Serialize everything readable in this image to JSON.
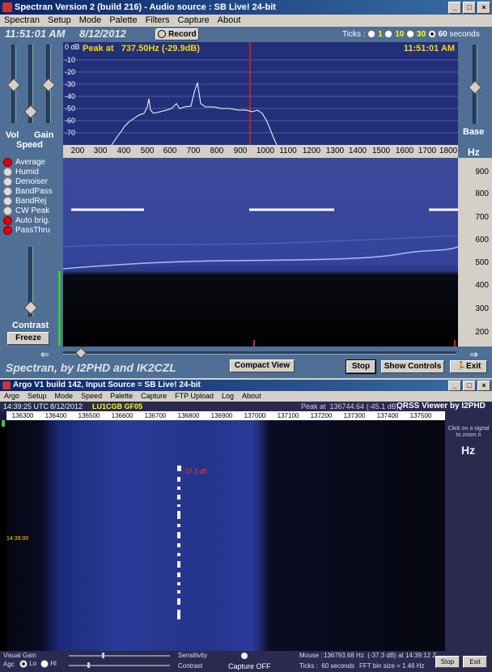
{
  "spectran": {
    "title": "Spectran Version 2 (build 216) - Audio source : SB Live! 24-bit",
    "menu": [
      "Spectran",
      "Setup",
      "Mode",
      "Palette",
      "Filters",
      "Capture",
      "About"
    ],
    "time": "11:51:01 AM",
    "date": "8/12/2012",
    "record_label": "Record",
    "ticks_label": "Ticks :",
    "ticks_options": [
      "1",
      "10",
      "30",
      "60"
    ],
    "ticks_selected": "60",
    "seconds_label": "seconds",
    "slider_labels": {
      "vol": "Vol",
      "gain": "Gain",
      "speed": "Speed",
      "contrast": "Contrast",
      "base": "Base",
      "hz": "Hz"
    },
    "options": [
      {
        "label": "Average",
        "on": true
      },
      {
        "label": "Humid",
        "on": false
      },
      {
        "label": "Denoiser",
        "on": false
      },
      {
        "label": "BandPass",
        "on": false
      },
      {
        "label": "BandRej",
        "on": false
      },
      {
        "label": "CW Peak",
        "on": false
      },
      {
        "label": "Auto brig.",
        "on": true
      },
      {
        "label": "PassThru",
        "on": true
      }
    ],
    "freeze_label": "Freeze",
    "spectrum": {
      "peak_text": "Peak at   737.50Hz (-29.9dB)",
      "time_text": "11:51:01 AM",
      "db_unit": "0 dB",
      "db_ticks": [
        "-10",
        "-20",
        "-30",
        "-40",
        "-50",
        "-60",
        "-70"
      ],
      "freq_ticks": [
        "200",
        "300",
        "400",
        "500",
        "600",
        "700",
        "800",
        "900",
        "1000",
        "1100",
        "1200",
        "1300",
        "1400",
        "1500",
        "1600",
        "1700",
        "1800"
      ],
      "waterfall_ticks": [
        "900",
        "800",
        "700",
        "600",
        "500",
        "400",
        "300",
        "200"
      ]
    },
    "brand": "Spectran, by I2PHD and IK2CZL",
    "compact_label": "Compact View",
    "stop_label": "Stop",
    "show_controls_label": "Show Controls",
    "exit_label": "Exit"
  },
  "argo": {
    "title": "Argo V1 build 142, Input Source = SB Live! 24-bit",
    "menu": [
      "Argo",
      "Setup",
      "Mode",
      "Speed",
      "Palette",
      "Capture",
      "FTP Upload",
      "Log",
      "About"
    ],
    "utc_time": "14:39:25 UTC",
    "date": "8/12/2012",
    "callsign": "LU1CGB GF05",
    "peak_text": "Peak at  136744.64 (-45.1 dB)",
    "brand": "QRSS Viewer by I2PHD",
    "freq_ticks": [
      "136300",
      "136400",
      "136500",
      "136600",
      "136700",
      "136800",
      "136900",
      "137000",
      "137100",
      "137200",
      "137300",
      "137400",
      "137500"
    ],
    "click_hint": "Click on a signal to zoom it",
    "hz_label": "Hz",
    "signal_label": "-37.3 dB",
    "time_marker": "14:39:00",
    "visual_gain_label": "Visual Gain",
    "agc_label": "Agc",
    "lo_label": "Lo",
    "hi_label": "Hi",
    "sensitivity_label": "Sensitivity",
    "contrast_label": "Contrast",
    "capture_label": "Capture OFF",
    "mouse_label": "Mouse :",
    "mouse_value": "136793.68 Hz  (-37.3 dB) at 14:39:12 Z",
    "ticks_label": "Ticks :  60 seconds",
    "fft_label": "FFT bin size = 1.46 Hz",
    "stop_label": "Stop",
    "exit_label": "Exit"
  }
}
